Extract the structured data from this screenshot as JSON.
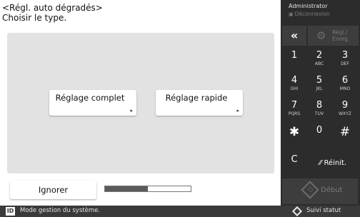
{
  "header": {
    "title": "<Régl. auto dégradés>",
    "subtitle": "Choisir le type."
  },
  "type_options": [
    {
      "label": "Réglage complet",
      "arrow": "▸"
    },
    {
      "label": "Réglage rapide",
      "arrow": "▸"
    }
  ],
  "footer_actions": {
    "ignore_label": "Ignorer",
    "progress_fraction": 0.5
  },
  "side_panel": {
    "user": "Administrator",
    "logout": "Déconnexion",
    "back_glyph": "«",
    "register_line1": "Régl./",
    "register_line2": "Enreg.",
    "keys": [
      {
        "digit": "1",
        "letters": ""
      },
      {
        "digit": "2",
        "letters": "ABC"
      },
      {
        "digit": "3",
        "letters": "DEF"
      },
      {
        "digit": "4",
        "letters": "GHI"
      },
      {
        "digit": "5",
        "letters": "JKL"
      },
      {
        "digit": "6",
        "letters": "MNO"
      },
      {
        "digit": "7",
        "letters": "PQRS"
      },
      {
        "digit": "8",
        "letters": "TUV"
      },
      {
        "digit": "9",
        "letters": "WXYZ"
      },
      {
        "digit": "✱",
        "letters": ""
      },
      {
        "digit": "0",
        "letters": ""
      },
      {
        "digit": "#",
        "letters": ""
      },
      {
        "digit": "C",
        "letters": ""
      }
    ],
    "reset_label": "Réinit.",
    "start_label": "Début"
  },
  "status_bar": {
    "badge": "ID",
    "message": "Mode gestion du système.",
    "suivi_label": "Suivi statut"
  },
  "colors": {
    "side_background": "#2c2c2c",
    "panel_background": "#e2e2e2",
    "progress_fill": "#5a5a5a"
  },
  "icons": {
    "back": "double-chevron-left-icon",
    "register": "gear-icon",
    "logout": "logout-icon",
    "reset": "eraser-icon",
    "start": "start-diamond-icon",
    "status": "status-diamond-icon",
    "option_arrow": "triangle-right-icon"
  }
}
